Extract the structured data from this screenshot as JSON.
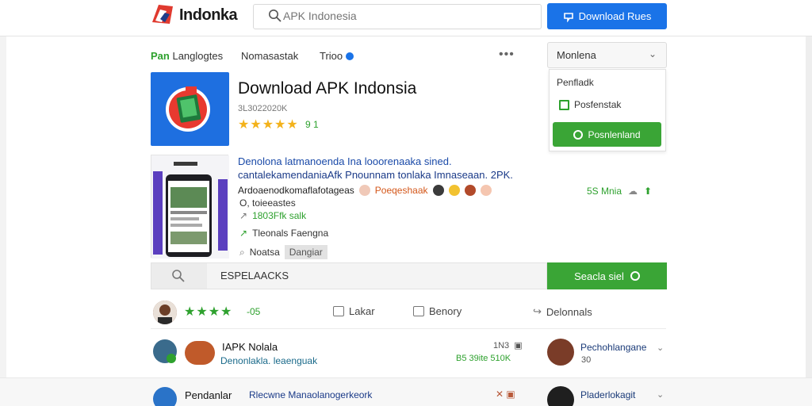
{
  "header": {
    "logo_text": "Indonka",
    "search_placeholder": "APK Indonesia",
    "download_button": "Download Rues"
  },
  "nav": {
    "item1_bold": "Pan",
    "item1_rest": "Langlogtes",
    "item2": "Nomasastak",
    "item3": "Trioo",
    "dropdown_value": "Monlena"
  },
  "menu": {
    "item1": "Penfladk",
    "item2": "Posfenstak",
    "button": "Posnlenland"
  },
  "app": {
    "title": "Download APK Indonsia",
    "meta": "3L3022020K",
    "stars": "★★★★★",
    "rating": "9 1",
    "desc_line1": "Denolona latmanoenda Ina looorenaaka sined.",
    "desc_line2": "cantalekamendaniaAfk Pnounnam tonlaka Imnaseaan. 2PK.",
    "row_a_text": "Ardoaenodkomaflafotageas",
    "row_a_tag": "Poeqeshaak",
    "stat_right": "5S Mnia",
    "meta1": "O, toieeastes",
    "meta2": "1803Ffk salk",
    "meta3": "Tleonals Faengna",
    "meta4_label": "Noatsa",
    "meta4_tag": "Dangiar"
  },
  "searchbar": {
    "value": "ESPELAACKS",
    "button": "Seacla siel"
  },
  "actions": {
    "stars": "★★★★",
    "rating": "-05",
    "like": "Lakar",
    "reply": "Benory",
    "share": "Delonnals"
  },
  "list": [
    {
      "title": "IAPK Nolala",
      "sub": "Denonlakla. leaenguak",
      "num_top": "1N3",
      "num_bottom": "B5 39ite 510K",
      "right_name": "Pechohlangane",
      "right_num": "30"
    },
    {
      "title": "Pendanlar",
      "sub": "Rlecwne Manaolanogerkeork",
      "num_top": "",
      "num_bottom": "",
      "right_name": "Pladerlokagit",
      "right_num": ""
    }
  ],
  "colors": {
    "primary_blue": "#1a73e8",
    "primary_green": "#3aa536",
    "star_yellow": "#f3b21b"
  }
}
